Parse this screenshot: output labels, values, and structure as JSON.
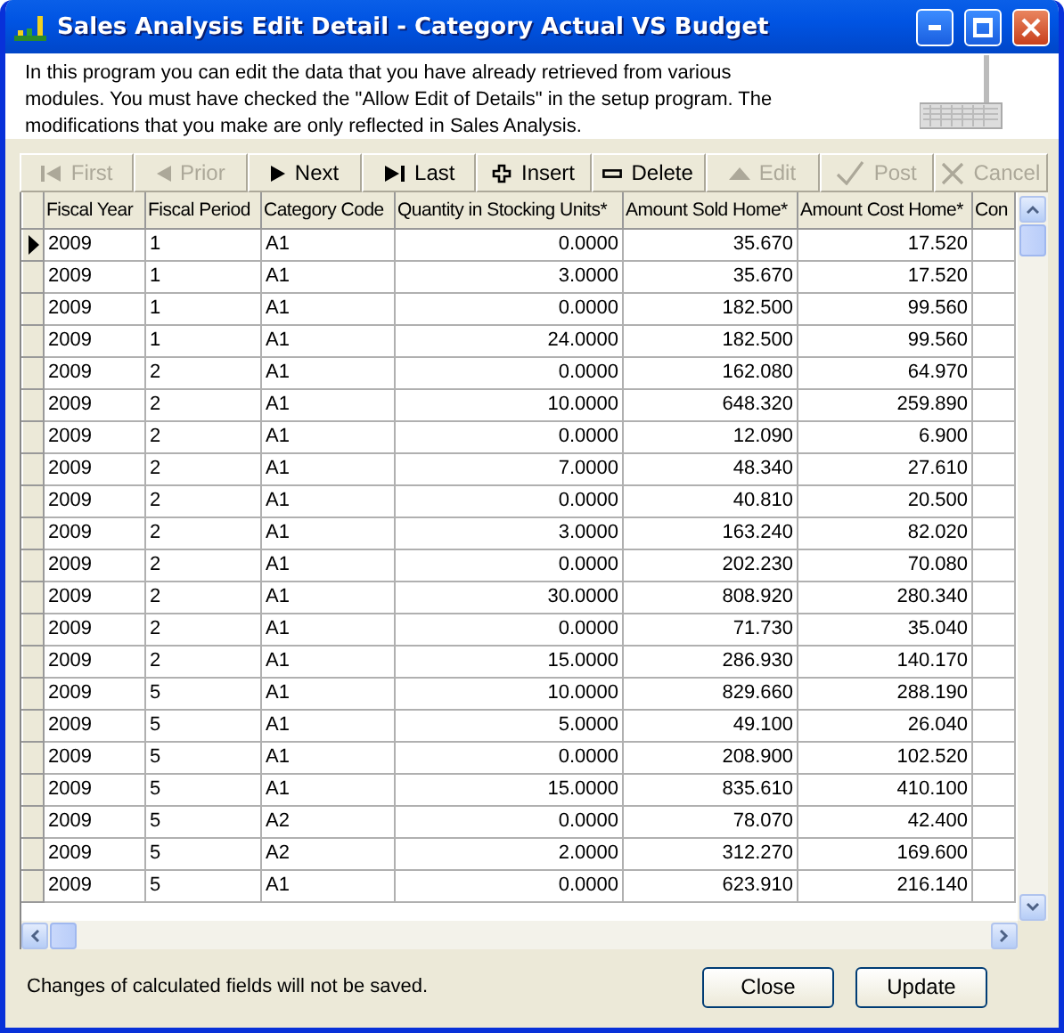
{
  "window": {
    "title": "Sales Analysis Edit Detail - Category Actual VS Budget"
  },
  "description": "In this program you can edit the data that you have already retrieved from various modules. You must have checked the \"Allow Edit of Details\" in the setup program. The modifications that you make are only reflected in Sales Analysis.",
  "toolbar": [
    {
      "kind": "first",
      "label": "First",
      "disabled": true
    },
    {
      "kind": "prior",
      "label": "Prior",
      "disabled": true
    },
    {
      "kind": "next",
      "label": "Next",
      "disabled": false
    },
    {
      "kind": "last",
      "label": "Last",
      "disabled": false
    },
    {
      "kind": "insert",
      "label": "Insert",
      "disabled": false
    },
    {
      "kind": "delete",
      "label": "Delete",
      "disabled": false
    },
    {
      "kind": "edit",
      "label": "Edit",
      "disabled": true
    },
    {
      "kind": "post",
      "label": "Post",
      "disabled": true
    },
    {
      "kind": "cancel",
      "label": "Cancel",
      "disabled": true
    }
  ],
  "table": {
    "columns": [
      "Fiscal Year",
      "Fiscal Period",
      "Category Code",
      "Quantity in Stocking Units*",
      "Amount Sold Home*",
      "Amount Cost Home*",
      "Con"
    ],
    "rows": [
      {
        "current": true,
        "cells": [
          "2009",
          "1",
          "A1",
          "0.0000",
          "35.670",
          "17.520"
        ]
      },
      {
        "current": false,
        "cells": [
          "2009",
          "1",
          "A1",
          "3.0000",
          "35.670",
          "17.520"
        ]
      },
      {
        "current": false,
        "cells": [
          "2009",
          "1",
          "A1",
          "0.0000",
          "182.500",
          "99.560"
        ]
      },
      {
        "current": false,
        "cells": [
          "2009",
          "1",
          "A1",
          "24.0000",
          "182.500",
          "99.560"
        ]
      },
      {
        "current": false,
        "cells": [
          "2009",
          "2",
          "A1",
          "0.0000",
          "162.080",
          "64.970"
        ]
      },
      {
        "current": false,
        "cells": [
          "2009",
          "2",
          "A1",
          "10.0000",
          "648.320",
          "259.890"
        ]
      },
      {
        "current": false,
        "cells": [
          "2009",
          "2",
          "A1",
          "0.0000",
          "12.090",
          "6.900"
        ]
      },
      {
        "current": false,
        "cells": [
          "2009",
          "2",
          "A1",
          "7.0000",
          "48.340",
          "27.610"
        ]
      },
      {
        "current": false,
        "cells": [
          "2009",
          "2",
          "A1",
          "0.0000",
          "40.810",
          "20.500"
        ]
      },
      {
        "current": false,
        "cells": [
          "2009",
          "2",
          "A1",
          "3.0000",
          "163.240",
          "82.020"
        ]
      },
      {
        "current": false,
        "cells": [
          "2009",
          "2",
          "A1",
          "0.0000",
          "202.230",
          "70.080"
        ]
      },
      {
        "current": false,
        "cells": [
          "2009",
          "2",
          "A1",
          "30.0000",
          "808.920",
          "280.340"
        ]
      },
      {
        "current": false,
        "cells": [
          "2009",
          "2",
          "A1",
          "0.0000",
          "71.730",
          "35.040"
        ]
      },
      {
        "current": false,
        "cells": [
          "2009",
          "2",
          "A1",
          "15.0000",
          "286.930",
          "140.170"
        ]
      },
      {
        "current": false,
        "cells": [
          "2009",
          "5",
          "A1",
          "10.0000",
          "829.660",
          "288.190"
        ]
      },
      {
        "current": false,
        "cells": [
          "2009",
          "5",
          "A1",
          "5.0000",
          "49.100",
          "26.040"
        ]
      },
      {
        "current": false,
        "cells": [
          "2009",
          "5",
          "A1",
          "0.0000",
          "208.900",
          "102.520"
        ]
      },
      {
        "current": false,
        "cells": [
          "2009",
          "5",
          "A1",
          "15.0000",
          "835.610",
          "410.100"
        ]
      },
      {
        "current": false,
        "cells": [
          "2009",
          "5",
          "A2",
          "0.0000",
          "78.070",
          "42.400"
        ]
      },
      {
        "current": false,
        "cells": [
          "2009",
          "5",
          "A2",
          "2.0000",
          "312.270",
          "169.600"
        ]
      },
      {
        "current": false,
        "cells": [
          "2009",
          "5",
          "A1",
          "0.0000",
          "623.910",
          "216.140"
        ]
      }
    ]
  },
  "footer": {
    "note": "Changes of calculated fields will not be saved.",
    "buttons": [
      "Close",
      "Update"
    ]
  }
}
